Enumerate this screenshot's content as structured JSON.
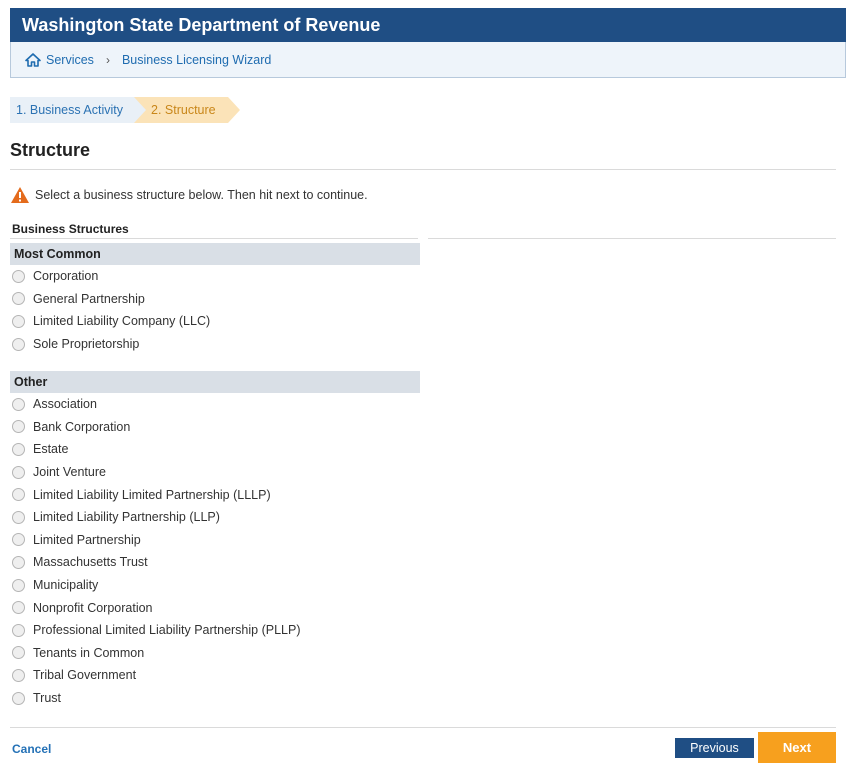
{
  "header": {
    "title": "Washington State Department of Revenue"
  },
  "breadcrumb": {
    "items": [
      "Services",
      "Business Licensing Wizard"
    ],
    "separator": "›"
  },
  "steps": [
    {
      "label": "1. Business Activity",
      "state": "completed"
    },
    {
      "label": "2. Structure",
      "state": "active"
    }
  ],
  "page_title": "Structure",
  "notice": {
    "text": "Select a business structure below. Then hit next to continue.",
    "icon": "warning-icon"
  },
  "business_structures": {
    "section_title": "Business Structures",
    "most_common": {
      "heading": "Most Common",
      "options": [
        "Corporation",
        "General Partnership",
        "Limited Liability Company (LLC)",
        "Sole Proprietorship"
      ]
    },
    "other": {
      "heading": "Other",
      "options": [
        "Association",
        "Bank Corporation",
        "Estate",
        "Joint Venture",
        "Limited Liability Limited Partnership (LLLP)",
        "Limited Liability Partnership (LLP)",
        "Limited Partnership",
        "Massachusetts Trust",
        "Municipality",
        "Nonprofit Corporation",
        "Professional Limited Liability Partnership (PLLP)",
        "Tenants in Common",
        "Tribal Government",
        "Trust"
      ]
    }
  },
  "footer": {
    "cancel_label": "Cancel",
    "previous_label": "Previous",
    "next_label": "Next"
  },
  "colors": {
    "header": "#1f4e84",
    "link": "#1f6cb0",
    "active_step": "#fbe3b8",
    "next_button": "#f7a01e",
    "warning": "#e46b1c"
  }
}
